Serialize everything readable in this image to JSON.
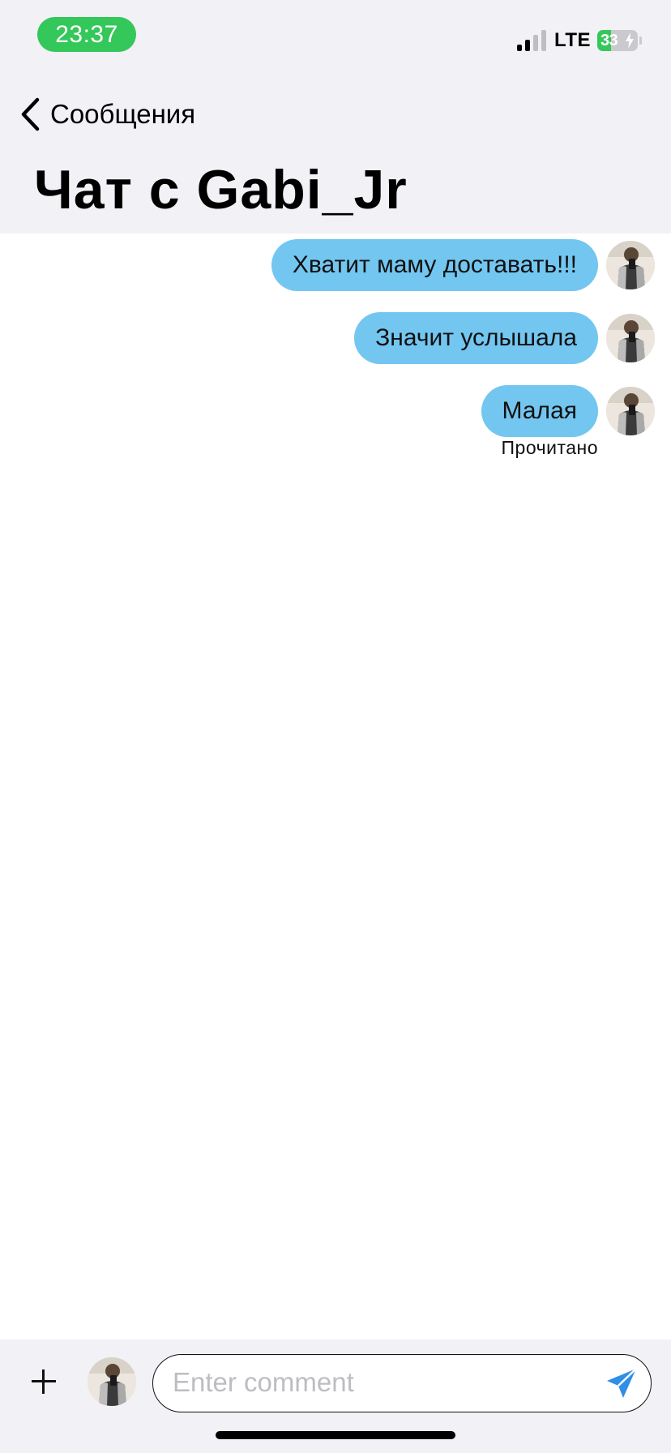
{
  "status_bar": {
    "time": "23:37",
    "network": "LTE",
    "battery_percent": 33,
    "battery_label": "33",
    "signal_bars_active": 2,
    "signal_bars_total": 4,
    "time_pill_color": "#34c759",
    "battery_fill_color": "#34c759"
  },
  "nav": {
    "back_label": "Сообщения",
    "back_icon": "chevron-left-icon"
  },
  "title": "Чат с Gabi_Jr",
  "messages": [
    {
      "text": "Хватит маму доставать!!!",
      "sender": "me"
    },
    {
      "text": "Значит услышала",
      "sender": "me"
    },
    {
      "text": "Малая",
      "sender": "me"
    }
  ],
  "read_status": "Прочитано",
  "composer": {
    "placeholder": "Enter comment",
    "value": "",
    "add_icon": "plus-icon",
    "send_icon": "send-icon"
  },
  "colors": {
    "bubble": "#73c6f0",
    "header_bg": "#f1f1f6",
    "send_icon": "#2f8ee6"
  }
}
